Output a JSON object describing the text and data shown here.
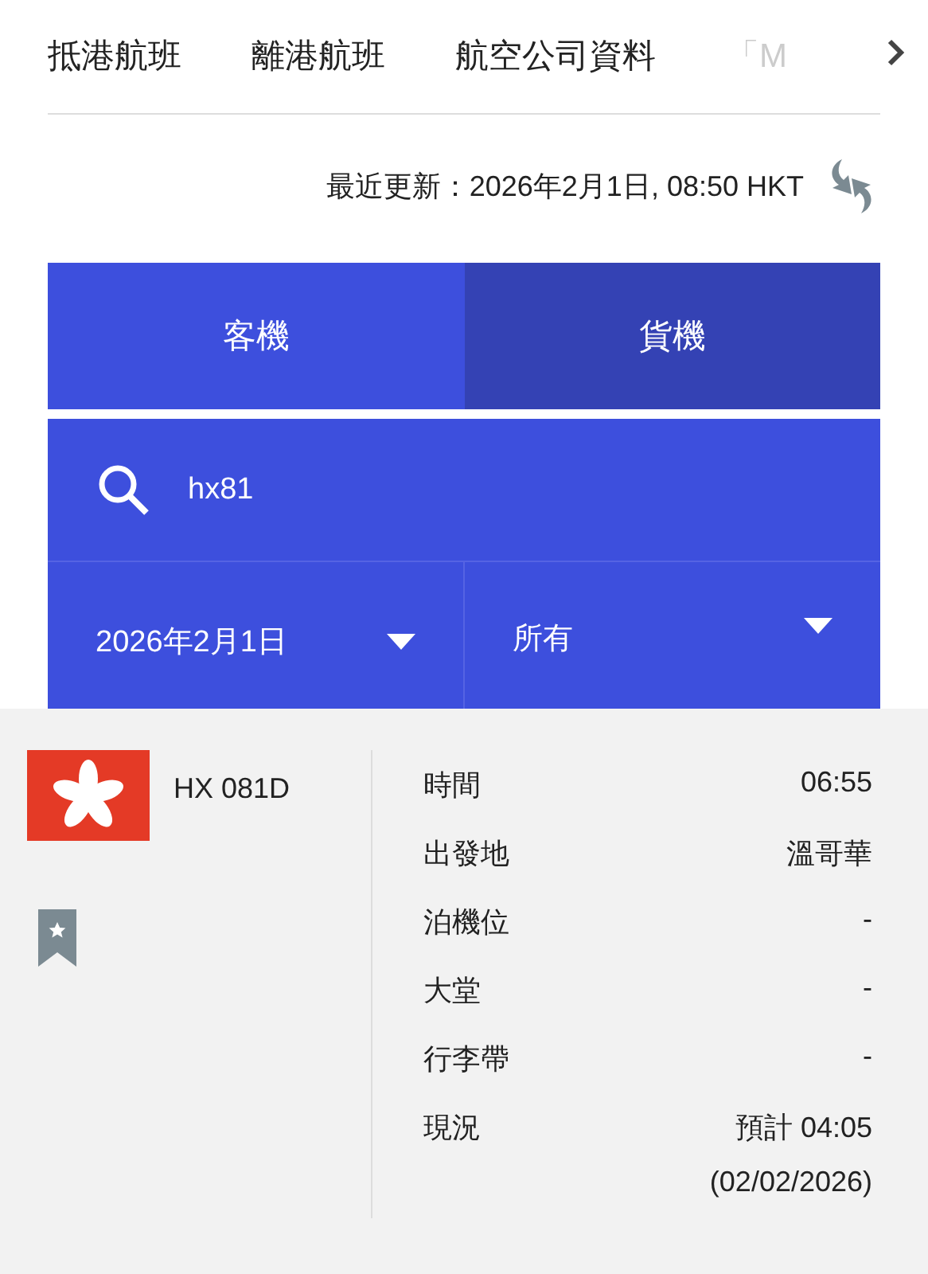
{
  "nav_tabs": [
    {
      "label": "抵港航班",
      "selected": false
    },
    {
      "label": "離港航班",
      "selected": false
    },
    {
      "label": "航空公司資料",
      "selected": false
    },
    {
      "label": "「M",
      "selected": false
    }
  ],
  "last_updated": "最近更新：2026年2月1日, 08:50 HKT",
  "flight_type_tabs": [
    {
      "label": "客機",
      "selected": true
    },
    {
      "label": "貨機",
      "selected": false
    }
  ],
  "search": {
    "value": "hx81"
  },
  "filters": [
    {
      "value": "2026年2月1日"
    },
    {
      "value": "所有"
    }
  ],
  "flight": {
    "number": "HX 081D",
    "bookmarked": false,
    "details": [
      {
        "label": "時間",
        "value": "06:55"
      },
      {
        "label": "出發地",
        "value": "溫哥華"
      },
      {
        "label": "泊機位",
        "value": "-"
      },
      {
        "label": "大堂",
        "value": "-"
      },
      {
        "label": "行李帶",
        "value": "-"
      },
      {
        "label": "現況",
        "value": "預計 04:05",
        "note": "(02/02/2026)"
      }
    ]
  }
}
